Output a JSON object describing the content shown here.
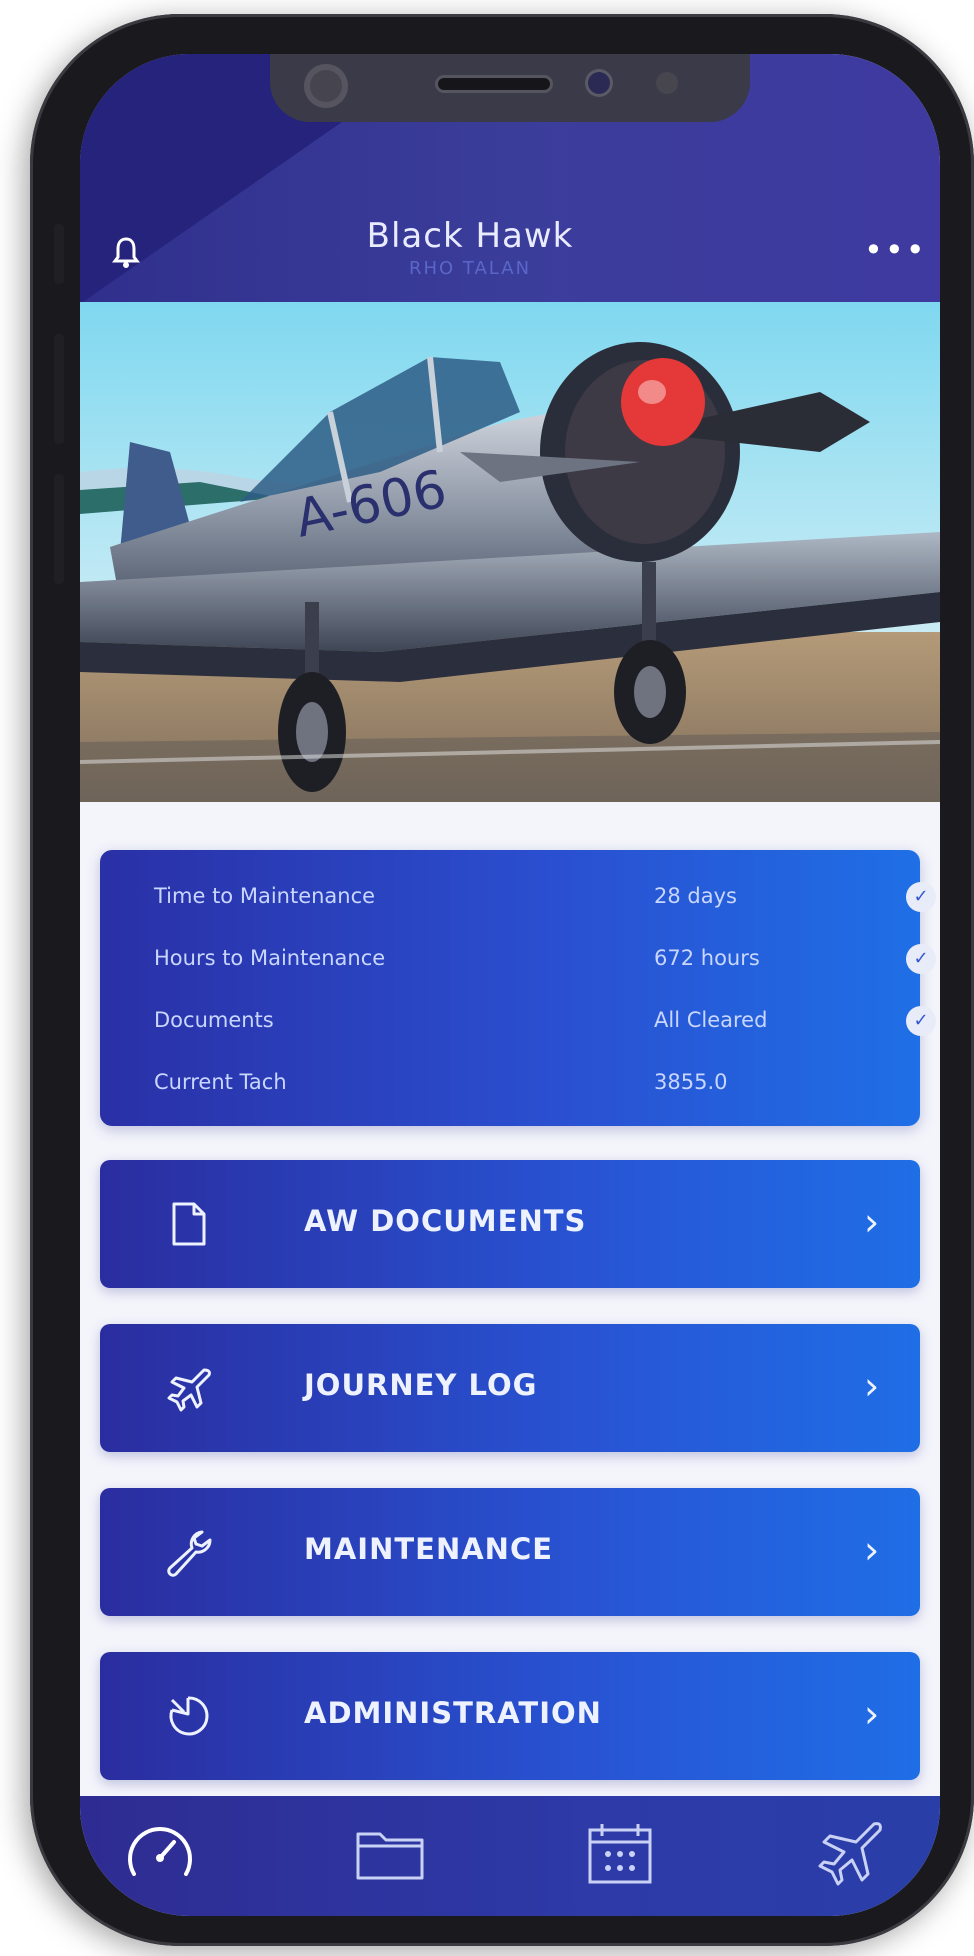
{
  "header": {
    "title": "Black Hawk",
    "subtitle": "RHO TALAN",
    "more_glyph": "•••",
    "bell_icon": "bell-icon"
  },
  "hero": {
    "alt": "Vintage silver propeller aircraft with red spinner parked on tarmac"
  },
  "status": {
    "rows": [
      {
        "label": "Time to Maintenance",
        "value": "28 days",
        "checked": true
      },
      {
        "label": "Hours to Maintenance",
        "value": "672 hours",
        "checked": true
      },
      {
        "label": "Documents",
        "value": "All Cleared",
        "checked": true
      },
      {
        "label": "Current Tach",
        "value": "3855.0",
        "checked": false
      }
    ]
  },
  "menu": [
    {
      "label": "AW DOCUMENTS",
      "icon": "document-icon"
    },
    {
      "label": "JOURNEY LOG",
      "icon": "airplane-icon"
    },
    {
      "label": "MAINTENANCE",
      "icon": "wrench-icon"
    },
    {
      "label": "ADMINISTRATION",
      "icon": "pointer-icon"
    }
  ],
  "chevron": "›",
  "tabs": [
    {
      "name": "dashboard",
      "icon": "speedometer-icon"
    },
    {
      "name": "folders",
      "icon": "folder-icon"
    },
    {
      "name": "calendar",
      "icon": "calendar-icon"
    },
    {
      "name": "flights",
      "icon": "airplane-icon"
    }
  ],
  "colors": {
    "header": "#3b3d9b",
    "accent": "#2854d4",
    "accent_light": "#1f6ee6",
    "text_light": "#eef2ff"
  }
}
